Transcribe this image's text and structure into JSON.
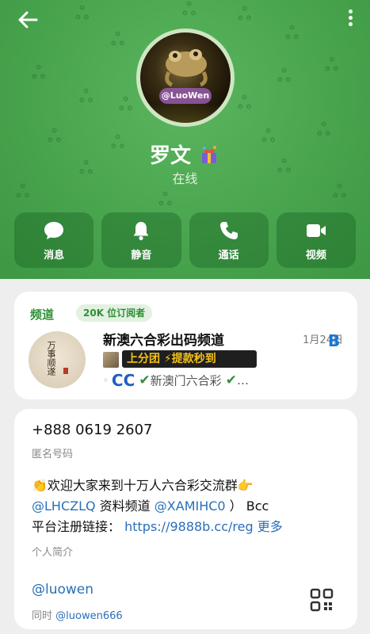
{
  "header": {
    "avatar_handle": "@LuoWen",
    "name": "罗文",
    "status": "在线",
    "actions": [
      {
        "label": "消息",
        "icon": "chat-bubble-icon"
      },
      {
        "label": "静音",
        "icon": "bell-icon"
      },
      {
        "label": "通话",
        "icon": "phone-icon"
      },
      {
        "label": "视频",
        "icon": "video-camera-icon"
      }
    ]
  },
  "channel": {
    "title": "频道",
    "subscribers": "20K 位订阅者",
    "name": "新澳六合彩出码频道",
    "date": "1月24日",
    "preview_banner": "上分团 ⚡提款秒到",
    "preview_text": "新澳门六合彩",
    "preview_suffix": "…",
    "badge_letter": "B",
    "cc_text": "CC"
  },
  "info": {
    "phone": "+888 0619 2607",
    "phone_label": "匿名号码",
    "bio_line1": "👏欢迎大家来到十万人六合彩交流群👉",
    "bio_link1": "@LHCZLQ",
    "bio_text1": " 资料频道 ",
    "bio_link2": "@XAMIHC0",
    "bio_text2": " ） Bcc",
    "bio_line3_prefix": "平台注册链接：",
    "bio_url": "https://9888b.cc/reg",
    "bio_more": "更多",
    "bio_label": "个人简介",
    "username": "@luowen",
    "also_prefix": "同时 ",
    "also_username": "@luowen666"
  },
  "colors": {
    "header_green": "#48a34d",
    "accent_green": "#2f8f35",
    "link_blue": "#2a6fb8"
  }
}
